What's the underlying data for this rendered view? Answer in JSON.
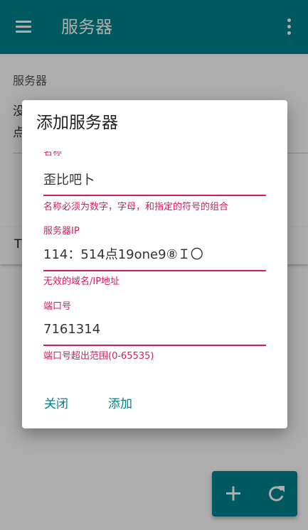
{
  "appbar": {
    "title": "服务器",
    "menu_icon": "menu-icon",
    "more_icon": "more-vert-icon",
    "color": "#00838f"
  },
  "page": {
    "section_label": "服务器",
    "hint_line1": "没",
    "hint_line2": "点",
    "tab_label": "T"
  },
  "fab": {
    "add_icon": "add-icon",
    "refresh_icon": "refresh-icon"
  },
  "dialog": {
    "title": "添加服务器",
    "fields": {
      "name": {
        "label": "名称",
        "value": "歪比吧卜",
        "error": "名称必须为数字，字母，和指定的符号的组合"
      },
      "ip": {
        "label": "服务器IP",
        "value": "114：514点19one9⑧Ｉ〇",
        "error": "无效的域名/IP地址"
      },
      "port": {
        "label": "端口号",
        "value": "7161314",
        "error": "端口号超出范围(0-65535)"
      }
    },
    "actions": {
      "close": "关闭",
      "add": "添加"
    },
    "error_color": "#d81b60",
    "accent_color": "#00838f"
  }
}
